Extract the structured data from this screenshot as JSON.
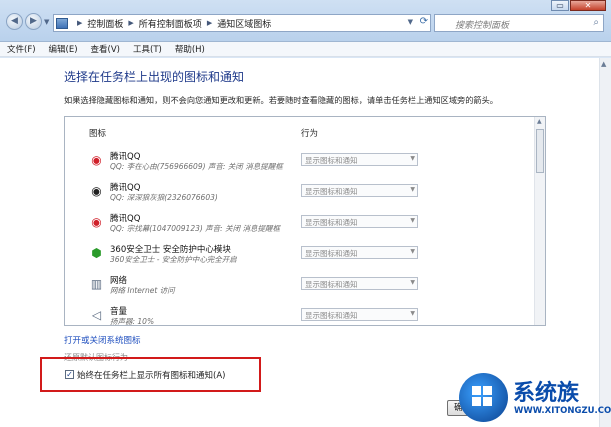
{
  "window": {
    "breadcrumb": [
      "控制面板",
      "所有控制面板项",
      "通知区域图标"
    ],
    "search_placeholder": "搜索控制面板",
    "close_label": "✕",
    "minimize_label": "▭"
  },
  "menu": [
    "文件(F)",
    "编辑(E)",
    "查看(V)",
    "工具(T)",
    "帮助(H)"
  ],
  "main": {
    "heading": "选择在任务栏上出现的图标和通知",
    "description": "如果选择隐藏图标和通知，则不会向您通知更改和更新。若要随时查看隐藏的图标，请单击任务栏上通知区域旁的箭头。",
    "columns": {
      "icon": "图标",
      "behavior": "行为"
    },
    "items": [
      {
        "name": "腾讯QQ",
        "detail": "QQ: 李在心由(756966609) 声音: 关闭 消息提醒框",
        "behavior": "显示图标和通知",
        "icon": "qq-icon"
      },
      {
        "name": "腾讯QQ",
        "detail": "QQ: 深深狼灰狼(2326076603)",
        "behavior": "显示图标和通知",
        "icon": "qq-icon"
      },
      {
        "name": "腾讯QQ",
        "detail": "QQ: 宗找幕(1047009123) 声音: 关闭 消息提醒框",
        "behavior": "显示图标和通知",
        "icon": "qq-icon"
      },
      {
        "name": "360安全卫士 安全防护中心模块",
        "detail": "360安全卫士 - 安全防护中心完全开启",
        "behavior": "显示图标和通知",
        "icon": "shield-icon"
      },
      {
        "name": "网络",
        "detail": "网络 Internet 访问",
        "behavior": "显示图标和通知",
        "icon": "network-icon"
      },
      {
        "name": "音量",
        "detail": "扬声器: 10%",
        "behavior": "显示图标和通知",
        "icon": "speaker-icon"
      }
    ],
    "system_icons_link": "打开或关闭系统图标",
    "restore_link": "还原默认图标行为",
    "always_show_label": "始终在任务栏上显示所有图标和通知(A)",
    "always_show_checked": true,
    "ok_button": "确定"
  },
  "watermark": {
    "text": "系统族",
    "url": "WWW.XITONGZU.COM"
  },
  "colors": {
    "heading": "#1f3a8a",
    "link": "#1f4fbf",
    "highlight": "#d21a1a",
    "watermark": "#0a4cab"
  }
}
